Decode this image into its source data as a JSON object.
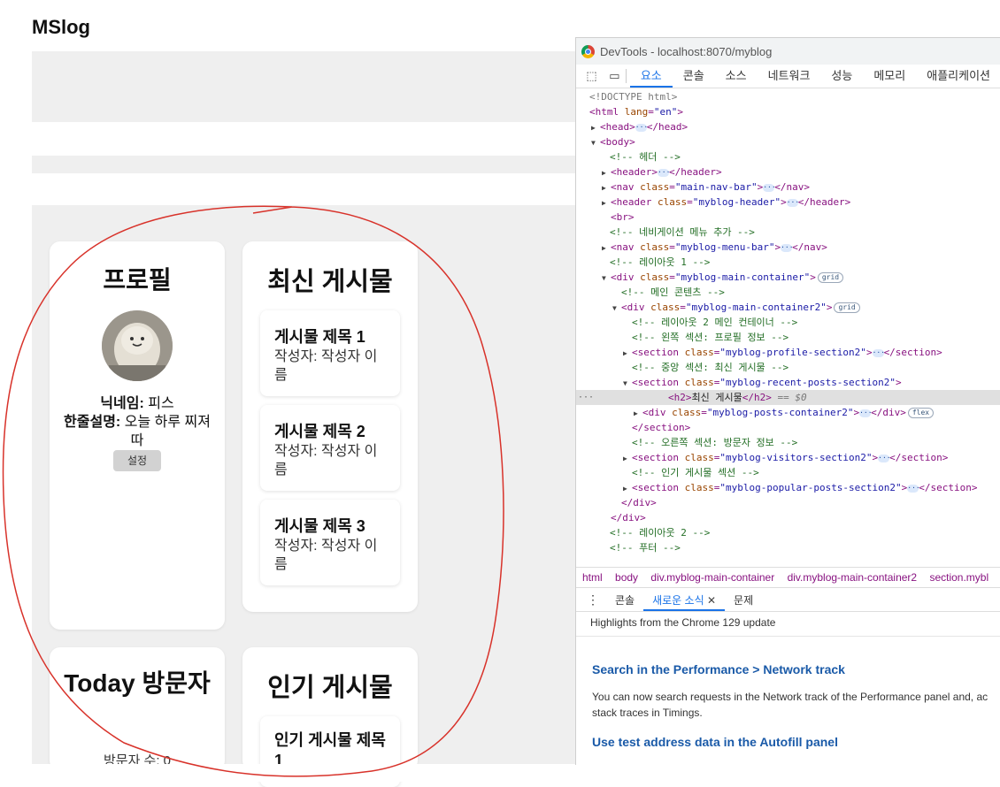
{
  "site": {
    "title": "MSlog"
  },
  "profile": {
    "heading": "프로필",
    "nickname_label": "닉네임:",
    "nickname_value": "피스",
    "bio_label": "한줄설명:",
    "bio_value": "오늘 하루 찌져따",
    "settings_label": "설정"
  },
  "recent": {
    "heading": "최신 게시물",
    "posts": [
      {
        "title": "게시물 제목 1",
        "author": "작성자: 작성자 이름"
      },
      {
        "title": "게시물 제목 2",
        "author": "작성자: 작성자 이름"
      },
      {
        "title": "게시물 제목 3",
        "author": "작성자: 작성자 이름"
      }
    ]
  },
  "visitors": {
    "heading": "Today 방문자",
    "count_text": "방문자 수: 0"
  },
  "popular": {
    "heading": "인기 게시물",
    "post_title": "인기 게시물 제목 1"
  },
  "devtools": {
    "window_title": "DevTools - localhost:8070/myblog",
    "tabs": [
      "요소",
      "콘솔",
      "소스",
      "네트워크",
      "성능",
      "메모리",
      "애플리케이션"
    ],
    "active_tab": "요소",
    "breadcrumb": [
      "html",
      "body",
      "div.myblog-main-container",
      "div.myblog-main-container2",
      "section.mybl"
    ],
    "drawer_tabs": [
      "콘솔",
      "새로운 소식",
      "문제"
    ],
    "whats_new": {
      "header": "Highlights from the Chrome 129 update",
      "item1_title": "Search in the Performance > Network track",
      "item1_desc_1": "You can now search requests in the Network track of the Performance panel and, ac",
      "item1_desc_2": "stack traces in Timings.",
      "item2_title": "Use test address data in the Autofill panel"
    },
    "badges": {
      "dots": "···",
      "grid": "grid",
      "flex": "flex",
      "selected_suffix": "== $0"
    },
    "dom": {
      "doctype": "<!DOCTYPE html>",
      "html_open": "<html",
      "lang_attr": "lang",
      "lang_value": "\"en\"",
      "head_open": "<head>",
      "head_close": "</head>",
      "body_open": "<body>",
      "c_header": "<!-- 헤더 -->",
      "header_open": "<header>",
      "header_close": "</header>",
      "nav_open": "<nav",
      "nav_close": "</nav>",
      "class_attr": "class",
      "v_main_nav": "\"main-nav-bar\"",
      "header2_open": "<header",
      "v_myblog_header": "\"myblog-header\"",
      "br": "<br>",
      "c_nav_menu": "<!-- 네비게이션 메뉴 추가 -->",
      "v_menu_bar": "\"myblog-menu-bar\"",
      "c_layout1": "<!-- 레이아웃 1 -->",
      "div_open": "<div",
      "div_close": "</div>",
      "v_main_container": "\"myblog-main-container\"",
      "c_main_content": "<!-- 메인 콘텐츠 -->",
      "v_main_container2": "\"myblog-main-container2\"",
      "c_layout2_main": "<!-- 레이아웃 2 메인 컨테이너 -->",
      "c_left_section": "<!-- 왼쪽 섹션: 프로필 정보 -->",
      "section_open": "<section",
      "section_close": "</section>",
      "v_profile_section": "\"myblog-profile-section2\"",
      "c_center_section": "<!-- 중앙 섹션: 최신 게시물 -->",
      "v_recent_section": "\"myblog-recent-posts-section2\"",
      "h2_open": "<h2>",
      "h2_text": "최신 게시물",
      "h2_close": "</h2>",
      "v_posts_container": "\"myblog-posts-container2\"",
      "c_right_section": "<!-- 오른쪽 섹션: 방문자 정보 -->",
      "v_visitors_section": "\"myblog-visitors-section2\"",
      "c_popular_section": "<!-- 인기 게시물 섹션 -->",
      "v_popular_section": "\"myblog-popular-posts-section2\"",
      "c_layout2": "<!-- 레이아웃 2 -->",
      "c_footer": "<!-- 푸터 -->"
    }
  }
}
